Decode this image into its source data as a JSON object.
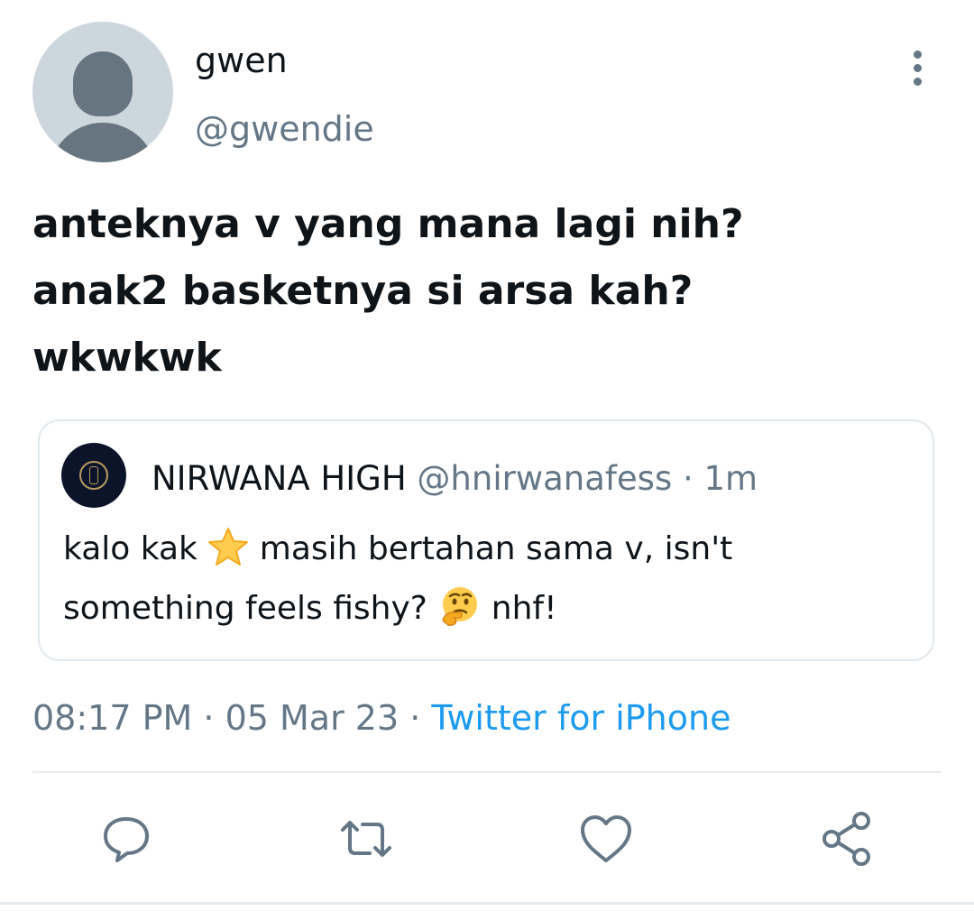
{
  "author": {
    "display_name": "gwen",
    "handle": "@gwendie",
    "avatar_icon": "default-avatar-icon"
  },
  "tweet": {
    "lines": [
      "anteknya v yang mana lagi nih?",
      "anak2 basketnya si arsa kah?",
      "wkwkwk"
    ]
  },
  "quote": {
    "name": "NIRWANA HIGH",
    "handle": "@hnirwanafess",
    "separator": "·",
    "time": "1m",
    "line1_before": "kalo kak",
    "line1_after": "masih bertahan sama v, isn't",
    "line2_before": "something feels fishy?",
    "line2_after": "nhf!",
    "emojis": [
      "star-emoji-icon",
      "thinking-face-emoji-icon"
    ]
  },
  "meta": {
    "time": "08:17 PM",
    "separator": "·",
    "date": "05 Mar 23",
    "source": "Twitter for iPhone"
  },
  "actions": [
    "reply-icon",
    "retweet-icon",
    "like-icon",
    "share-icon"
  ],
  "colors": {
    "text": "#0f1419",
    "secondary": "#657786",
    "link": "#1d9bf0",
    "border": "#e1e8ed"
  }
}
